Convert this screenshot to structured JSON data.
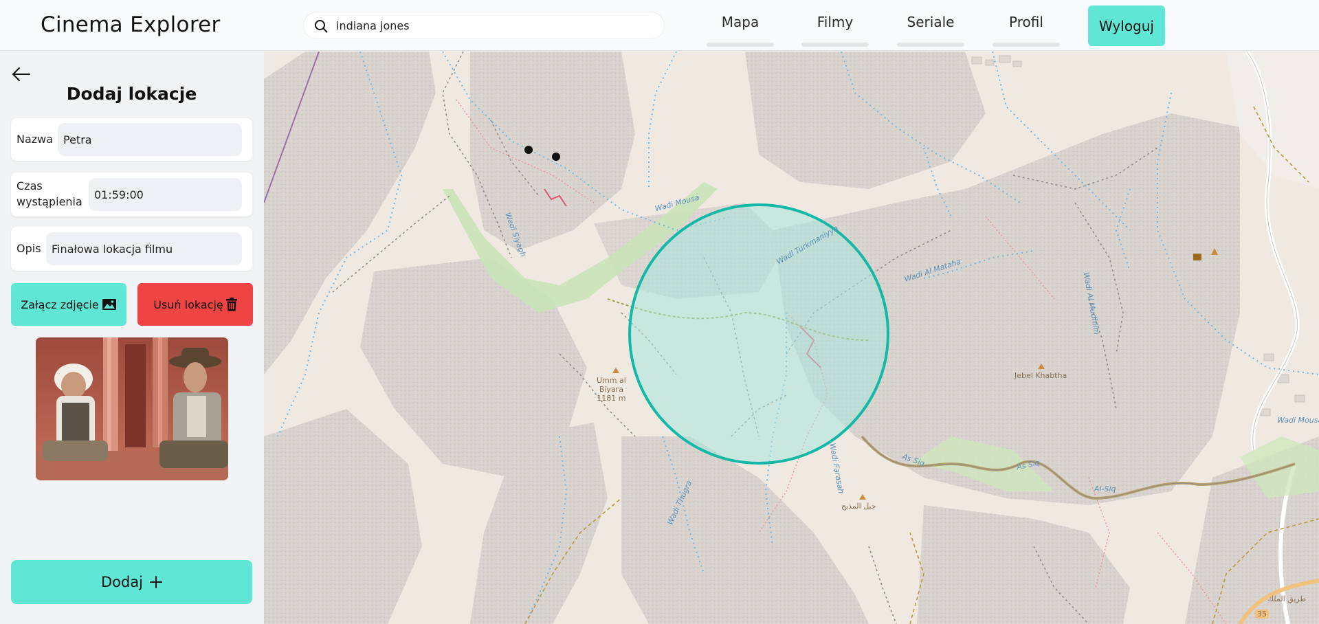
{
  "header": {
    "app_title": "Cinema Explorer",
    "search": {
      "value": "indiana jones",
      "icon": "search-icon"
    },
    "nav": [
      {
        "label": "Mapa"
      },
      {
        "label": "Filmy"
      },
      {
        "label": "Seriale"
      },
      {
        "label": "Profil"
      }
    ],
    "logout_label": "Wyloguj"
  },
  "sidebar": {
    "back_icon": "arrow-left-icon",
    "title": "Dodaj lokacje",
    "fields": {
      "name": {
        "label": "Nazwa",
        "value": "Petra"
      },
      "time": {
        "label_line1": "Czas",
        "label_line2": "wystąpienia",
        "value": "01:59:00"
      },
      "description": {
        "label": "Opis",
        "value": "Finałowa lokacja filmu"
      }
    },
    "attach_photo_label": "Załącz zdjęcie",
    "remove_location_label": "Usuń lokację",
    "add_label": "Dodaj"
  },
  "map": {
    "labels": {
      "wadi_mousa_1": "Wadi Mousa",
      "wadi_siyagh": "Wadi Siyagh",
      "wadi_turkmaniyya": "Wadi Turkmaniyya",
      "wadi_al_mataha": "Wadi Al Mataha",
      "wadi_al_mudhlim": "Wadi Al Mudhlim",
      "jebel_khabtha": "Jebel Khabtha",
      "umm_al_biyara_line1": "Umm al",
      "umm_al_biyara_line2": "Biyara",
      "umm_al_biyara_line3": "1181 m",
      "wadi_farasah": "Wadi Farasah",
      "wadi_thugra": "Wadi Thugra",
      "jabal_arabic": "جبل المذبح",
      "as_siq_1": "As Siq",
      "as_siq_2": "As Siq",
      "al_siq": "Al-Siq",
      "wadi_mousa_2": "Wadi Mousa",
      "road_arabic": "طريق الملك",
      "road_number": "35"
    },
    "accent_circle": "#14b8a6",
    "circle_fill": "#a8e6dc"
  },
  "colors": {
    "accent": "#5fe6d4",
    "danger": "#ef4444",
    "map_base": "#efe9e2",
    "rock": "#d5d0cb",
    "water": "#73b5e0"
  }
}
